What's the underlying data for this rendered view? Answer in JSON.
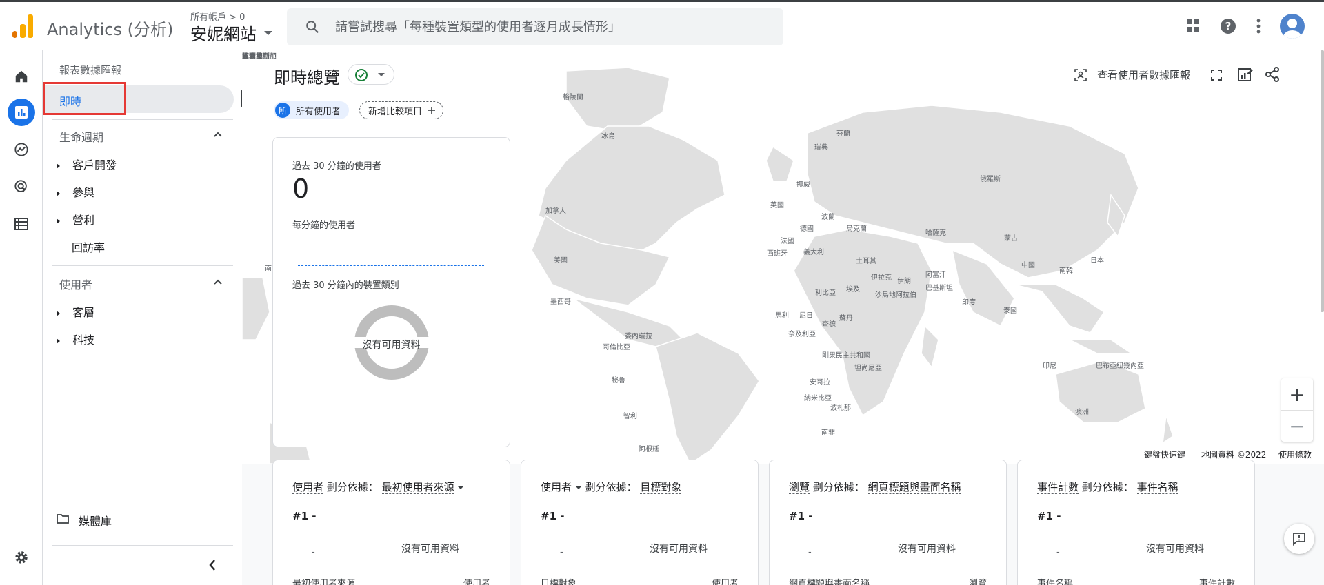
{
  "app": {
    "title": "Analytics (分析)",
    "account_path": "所有帳戶 > 0",
    "property_name": "安妮網站"
  },
  "search": {
    "placeholder": "請嘗試搜尋「每種裝置類型的使用者逐月成長情形」"
  },
  "icons": {
    "apps": "apps-grid-icon",
    "help": "help-icon",
    "more": "more-vert-icon",
    "avatar": "account-avatar",
    "rail": [
      "home-icon",
      "reports-icon",
      "explore-icon",
      "advertising-icon",
      "configure-icon",
      "settings-icon"
    ]
  },
  "sidebar": {
    "header": "報表數據匯報",
    "selected": "即時",
    "tooltip": "即時",
    "lifecycle": {
      "title": "生命週期",
      "items": [
        {
          "label": "客戶開發",
          "expandable": true
        },
        {
          "label": "參與",
          "expandable": true
        },
        {
          "label": "營利",
          "expandable": true
        },
        {
          "label": "回訪率",
          "expandable": false
        }
      ]
    },
    "users": {
      "title": "使用者",
      "items": [
        {
          "label": "客層",
          "expandable": true
        },
        {
          "label": "科技",
          "expandable": true
        }
      ]
    },
    "library": "媒體庫"
  },
  "main": {
    "title": "即時總覽",
    "segment_badge": "所",
    "segment": "所有使用者",
    "add_comparison": "新增比較項目",
    "view_snapshot": "查看使用者數據匯報",
    "kpi": {
      "label": "過去 30 分鐘的使用者",
      "value": "0",
      "per_minute": "每分鐘的使用者",
      "device_label": "過去 30 分鐘內的裝置類別",
      "no_data": "沒有可用資料"
    },
    "map_labels": [
      "格陵蘭",
      "冰島",
      "瑞典",
      "芬蘭",
      "挪威",
      "俄羅斯",
      "加拿大",
      "英國",
      "波蘭",
      "德國",
      "烏克蘭",
      "哈薩克",
      "蒙古",
      "法國",
      "義大利",
      "西班牙",
      "土耳其",
      "中國",
      "日本",
      "美國",
      "伊拉克",
      "伊朗",
      "阿富汗",
      "巴基斯坦",
      "南韓",
      "阿爾及利亞",
      "利比亞",
      "埃及",
      "沙烏地阿拉伯",
      "印度",
      "墨西哥",
      "馬利",
      "尼日",
      "蘇丹",
      "泰國",
      "委內瑞拉",
      "哥倫比亞",
      "查德",
      "奈及利亞",
      "衣索比亞",
      "秘魯",
      "巴西",
      "剛果民主共和國",
      "肯亞",
      "坦尚尼亞",
      "印尼",
      "巴布亞紐幾內亞",
      "玻利維亞",
      "安哥拉",
      "納米比亞",
      "波札那",
      "馬達加斯加",
      "澳洲",
      "智利",
      "阿根廷",
      "南非",
      "紐西蘭",
      "南"
    ],
    "map_attribution": {
      "shortcuts": "鍵盤快速鍵",
      "data": "地圖資料 ©2022",
      "terms": "使用條款"
    },
    "zoom": {
      "in": "+",
      "out": "−"
    },
    "cards": [
      {
        "metric": "使用者",
        "by": "劃分依據：",
        "dim": "最初使用者來源",
        "rank": "#1  -",
        "no_data": "沒有可用資料",
        "dash": "-",
        "col1": "最初使用者來源",
        "col2": "使用者"
      },
      {
        "metric": "使用者",
        "by": "劃分依據：",
        "dim": "目標對象",
        "rank": "#1  -",
        "no_data": "沒有可用資料",
        "dash": "-",
        "col1": "目標對象",
        "col2": "使用者"
      },
      {
        "metric": "瀏覽",
        "by": "劃分依據：",
        "dim": "網頁標題與畫面名稱",
        "rank": "#1  -",
        "no_data": "沒有可用資料",
        "dash": "-",
        "col1": "網頁標題與畫面名稱",
        "col2": "瀏覽"
      },
      {
        "metric": "事件計數",
        "by": "劃分依據：",
        "dim": "事件名稱",
        "rank": "#1  -",
        "no_data": "沒有可用資料",
        "dash": "-",
        "col1": "事件名稱",
        "col2": "事件計數"
      }
    ]
  },
  "colors": {
    "accent": "#1a73e8",
    "highlight_box": "#e53935",
    "logo_orange": "#f9ab00",
    "logo_dark": "#e37400"
  }
}
